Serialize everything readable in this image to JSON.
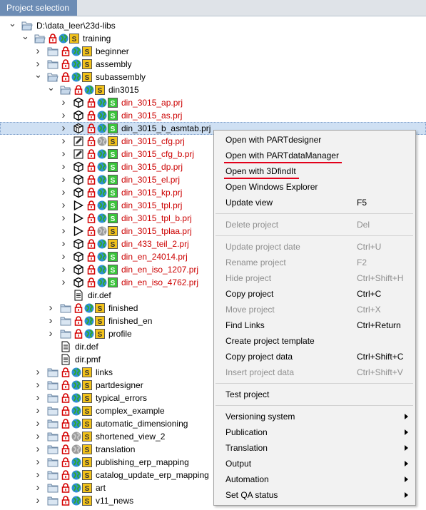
{
  "tab": {
    "label": "Project selection"
  },
  "tree": [
    {
      "level": 0,
      "exp": "v",
      "icons": [
        "folder-open"
      ],
      "label": "D:\\data_leer\\23d-libs"
    },
    {
      "level": 1,
      "exp": "v",
      "icons": [
        "folder-open",
        "lock",
        "globe",
        "s-yellow"
      ],
      "label": "training"
    },
    {
      "level": 2,
      "exp": ">",
      "icons": [
        "folder",
        "lock",
        "globe",
        "s-yellow"
      ],
      "label": "beginner"
    },
    {
      "level": 2,
      "exp": ">",
      "icons": [
        "folder",
        "lock",
        "globe",
        "s-yellow"
      ],
      "label": "assembly"
    },
    {
      "level": 2,
      "exp": "v",
      "icons": [
        "folder-open",
        "lock",
        "globe",
        "s-yellow"
      ],
      "label": "subassembly"
    },
    {
      "level": 3,
      "exp": "v",
      "icons": [
        "folder-open",
        "lock",
        "globe",
        "s-yellow"
      ],
      "label": "din3015"
    },
    {
      "level": 4,
      "exp": ">",
      "icons": [
        "cube",
        "lock",
        "globe",
        "s-green"
      ],
      "label": "din_3015_ap.prj",
      "red": true
    },
    {
      "level": 4,
      "exp": ">",
      "icons": [
        "cube",
        "lock",
        "globe",
        "s-green"
      ],
      "label": "din_3015_as.prj",
      "red": true
    },
    {
      "level": 4,
      "exp": ">",
      "icons": [
        "cube-multi",
        "lock",
        "globe",
        "s-green"
      ],
      "label": "din_3015_b_asmtab.prj",
      "red": false,
      "selected": true
    },
    {
      "level": 4,
      "exp": ">",
      "icons": [
        "pencil",
        "lock",
        "globe-gray",
        "s-yellow"
      ],
      "label": "din_3015_cfg.prj",
      "red": true
    },
    {
      "level": 4,
      "exp": ">",
      "icons": [
        "pencil",
        "lock",
        "globe",
        "s-green"
      ],
      "label": "din_3015_cfg_b.prj",
      "red": true
    },
    {
      "level": 4,
      "exp": ">",
      "icons": [
        "cube",
        "lock",
        "globe",
        "s-green"
      ],
      "label": "din_3015_dp.prj",
      "red": true
    },
    {
      "level": 4,
      "exp": ">",
      "icons": [
        "cube",
        "lock",
        "globe",
        "s-green"
      ],
      "label": "din_3015_el.prj",
      "red": true
    },
    {
      "level": 4,
      "exp": ">",
      "icons": [
        "cube",
        "lock",
        "globe",
        "s-green"
      ],
      "label": "din_3015_kp.prj",
      "red": true
    },
    {
      "level": 4,
      "exp": ">",
      "icons": [
        "triangle",
        "lock",
        "globe",
        "s-green"
      ],
      "label": "din_3015_tpl.prj",
      "red": true
    },
    {
      "level": 4,
      "exp": ">",
      "icons": [
        "triangle",
        "lock",
        "globe",
        "s-green"
      ],
      "label": "din_3015_tpl_b.prj",
      "red": true
    },
    {
      "level": 4,
      "exp": ">",
      "icons": [
        "triangle",
        "lock",
        "globe-gray",
        "s-yellow"
      ],
      "label": "din_3015_tplaa.prj",
      "red": true
    },
    {
      "level": 4,
      "exp": ">",
      "icons": [
        "cube",
        "lock",
        "globe",
        "s-yellow"
      ],
      "label": "din_433_teil_2.prj",
      "red": true
    },
    {
      "level": 4,
      "exp": ">",
      "icons": [
        "cube",
        "lock",
        "globe",
        "s-green"
      ],
      "label": "din_en_24014.prj",
      "red": true
    },
    {
      "level": 4,
      "exp": ">",
      "icons": [
        "cube",
        "lock",
        "globe",
        "s-green"
      ],
      "label": "din_en_iso_1207.prj",
      "red": true
    },
    {
      "level": 4,
      "exp": ">",
      "icons": [
        "cube",
        "lock",
        "globe",
        "s-green"
      ],
      "label": "din_en_iso_4762.prj",
      "red": true
    },
    {
      "level": 4,
      "exp": "",
      "icons": [
        "doc"
      ],
      "label": "dir.def"
    },
    {
      "level": 3,
      "exp": ">",
      "icons": [
        "folder",
        "lock",
        "globe",
        "s-yellow"
      ],
      "label": "finished"
    },
    {
      "level": 3,
      "exp": ">",
      "icons": [
        "folder",
        "lock",
        "globe",
        "s-yellow"
      ],
      "label": "finished_en"
    },
    {
      "level": 3,
      "exp": ">",
      "icons": [
        "folder",
        "lock",
        "globe",
        "s-yellow"
      ],
      "label": "profile"
    },
    {
      "level": 3,
      "exp": "",
      "icons": [
        "doc"
      ],
      "label": "dir.def"
    },
    {
      "level": 3,
      "exp": "",
      "icons": [
        "doc"
      ],
      "label": "dir.pmf"
    },
    {
      "level": 2,
      "exp": ">",
      "icons": [
        "folder",
        "lock",
        "globe",
        "s-yellow"
      ],
      "label": "links"
    },
    {
      "level": 2,
      "exp": ">",
      "icons": [
        "folder",
        "lock",
        "globe",
        "s-yellow"
      ],
      "label": "partdesigner"
    },
    {
      "level": 2,
      "exp": ">",
      "icons": [
        "folder",
        "lock",
        "globe",
        "s-yellow"
      ],
      "label": "typical_errors"
    },
    {
      "level": 2,
      "exp": ">",
      "icons": [
        "folder",
        "lock",
        "globe",
        "s-yellow"
      ],
      "label": "complex_example"
    },
    {
      "level": 2,
      "exp": ">",
      "icons": [
        "folder",
        "lock",
        "globe",
        "s-yellow"
      ],
      "label": "automatic_dimensioning"
    },
    {
      "level": 2,
      "exp": ">",
      "icons": [
        "folder",
        "lock",
        "globe-gray",
        "s-yellow"
      ],
      "label": "shortened_view_2"
    },
    {
      "level": 2,
      "exp": ">",
      "icons": [
        "folder",
        "lock",
        "globe-gray",
        "s-yellow"
      ],
      "label": "translation"
    },
    {
      "level": 2,
      "exp": ">",
      "icons": [
        "folder",
        "lock",
        "globe",
        "s-yellow"
      ],
      "label": "publishing_erp_mapping"
    },
    {
      "level": 2,
      "exp": ">",
      "icons": [
        "folder",
        "lock",
        "globe",
        "s-yellow"
      ],
      "label": "catalog_update_erp_mapping"
    },
    {
      "level": 2,
      "exp": ">",
      "icons": [
        "folder",
        "lock",
        "globe",
        "s-yellow"
      ],
      "label": "art"
    },
    {
      "level": 2,
      "exp": ">",
      "icons": [
        "folder",
        "lock",
        "globe",
        "s-yellow"
      ],
      "label": "v11_news"
    }
  ],
  "menu": [
    {
      "type": "item",
      "label": "Open with PARTdesigner",
      "shortcut": "",
      "disabled": false
    },
    {
      "type": "item",
      "label": "Open with PARTdataManager",
      "shortcut": "",
      "disabled": false,
      "underline": true
    },
    {
      "type": "item",
      "label": "Open with 3DfindIt",
      "shortcut": "",
      "disabled": false,
      "underline": true
    },
    {
      "type": "item",
      "label": "Open Windows Explorer",
      "shortcut": "",
      "disabled": false
    },
    {
      "type": "item",
      "label": "Update view",
      "shortcut": "F5",
      "disabled": false
    },
    {
      "type": "sep"
    },
    {
      "type": "item",
      "label": "Delete project",
      "shortcut": "Del",
      "disabled": true
    },
    {
      "type": "sep"
    },
    {
      "type": "item",
      "label": "Update project date",
      "shortcut": "Ctrl+U",
      "disabled": true
    },
    {
      "type": "item",
      "label": "Rename project",
      "shortcut": "F2",
      "disabled": true
    },
    {
      "type": "item",
      "label": "Hide project",
      "shortcut": "Ctrl+Shift+H",
      "disabled": true
    },
    {
      "type": "item",
      "label": "Copy project",
      "shortcut": "Ctrl+C",
      "disabled": false
    },
    {
      "type": "item",
      "label": "Move project",
      "shortcut": "Ctrl+X",
      "disabled": true
    },
    {
      "type": "item",
      "label": "Find Links",
      "shortcut": "Ctrl+Return",
      "disabled": false
    },
    {
      "type": "item",
      "label": "Create project template",
      "shortcut": "",
      "disabled": false
    },
    {
      "type": "item",
      "label": "Copy project data",
      "shortcut": "Ctrl+Shift+C",
      "disabled": false
    },
    {
      "type": "item",
      "label": "Insert project data",
      "shortcut": "Ctrl+Shift+V",
      "disabled": true
    },
    {
      "type": "sep"
    },
    {
      "type": "item",
      "label": "Test project",
      "shortcut": "",
      "disabled": false
    },
    {
      "type": "sep"
    },
    {
      "type": "item",
      "label": "Versioning system",
      "shortcut": "",
      "disabled": false,
      "submenu": true
    },
    {
      "type": "item",
      "label": "Publication",
      "shortcut": "",
      "disabled": false,
      "submenu": true
    },
    {
      "type": "item",
      "label": "Translation",
      "shortcut": "",
      "disabled": false,
      "submenu": true
    },
    {
      "type": "item",
      "label": "Output",
      "shortcut": "",
      "disabled": false,
      "submenu": true
    },
    {
      "type": "item",
      "label": "Automation",
      "shortcut": "",
      "disabled": false,
      "submenu": true
    },
    {
      "type": "item",
      "label": "Set QA status",
      "shortcut": "",
      "disabled": false,
      "submenu": true
    }
  ]
}
